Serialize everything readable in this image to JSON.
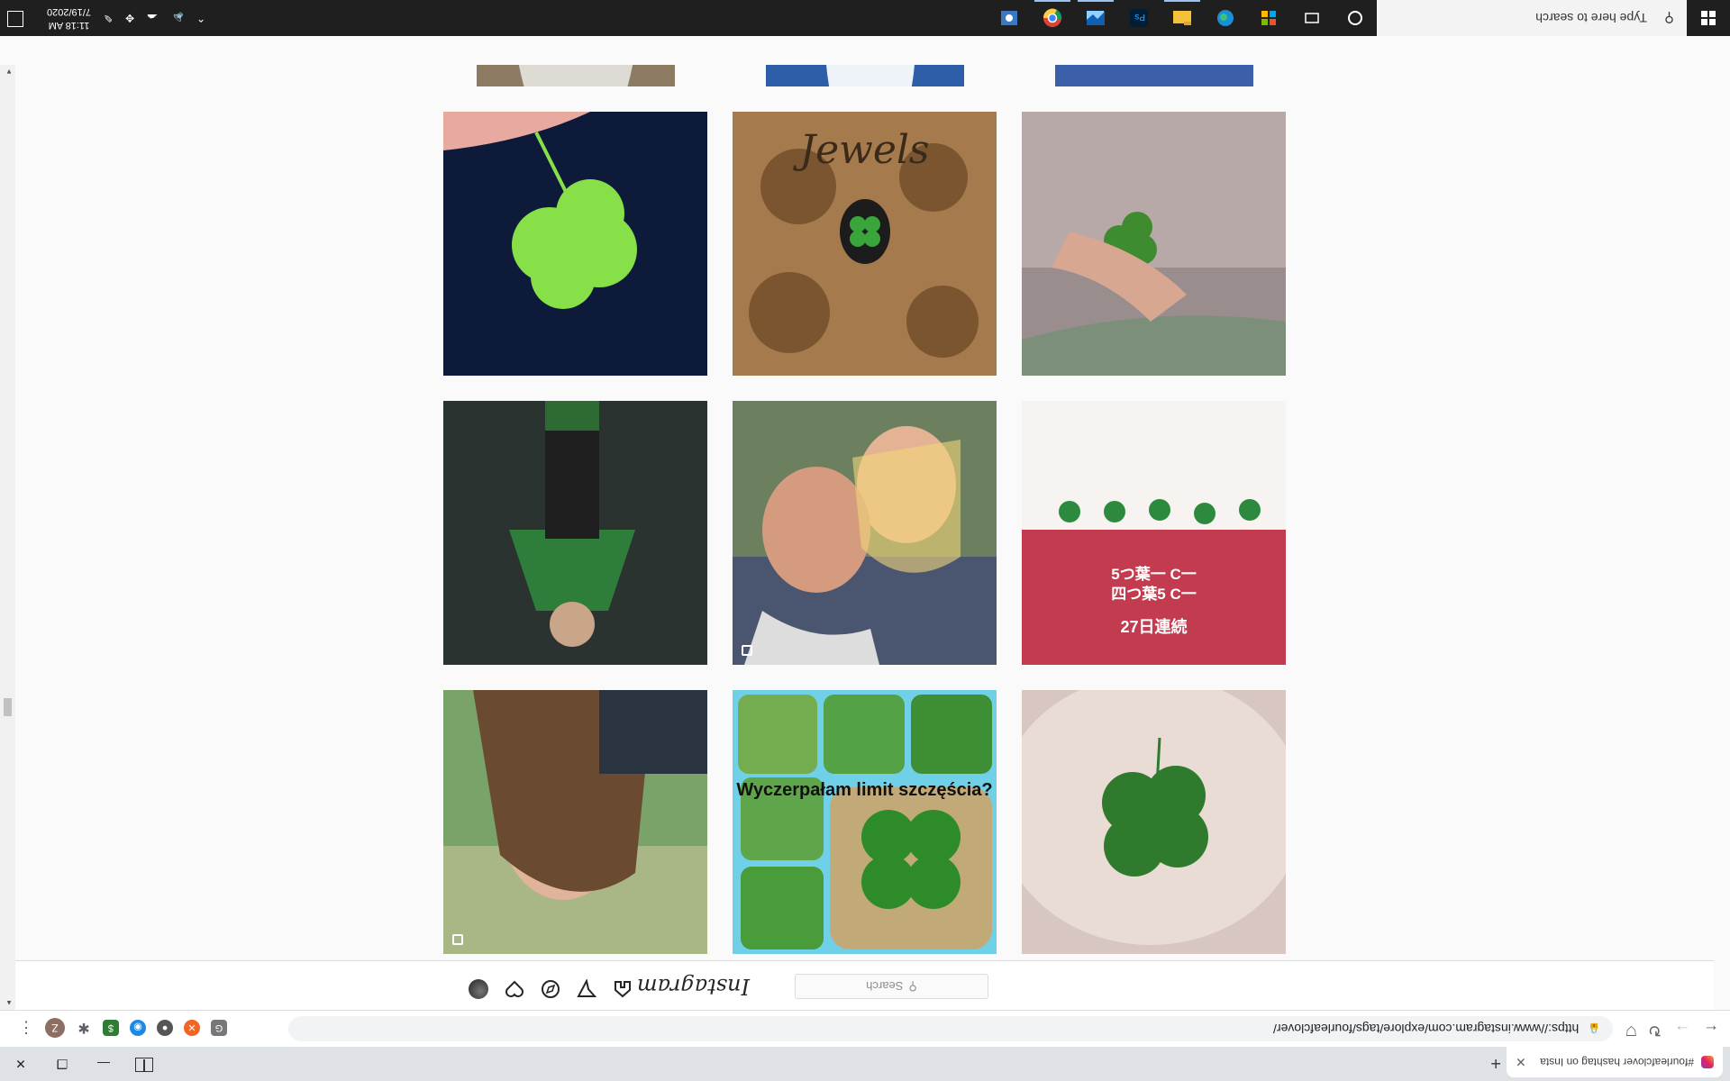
{
  "browser": {
    "tab_title": "#fourleafclover hashtag on Insta",
    "new_tab": "+",
    "url": "https://www.instagram.com/explore/tags/fourleafclover/",
    "profile_initial": "Z"
  },
  "instagram": {
    "logo": "Instagram",
    "search_placeholder": "Search",
    "grid_texts": {
      "jewels": "Jewels",
      "wyczerpalam": "Wyczerpałam limit szczęścia?",
      "jp_top": "27日連続",
      "jp_mid": "四つ葉5 C一",
      "jp_low": "5つ葉一 C一"
    }
  },
  "taskbar": {
    "search_placeholder": "Type here to search",
    "time": "11:18 AM",
    "date": "7/19/2020"
  },
  "colors": {
    "instagram_gradient_start": "#f9a03c",
    "taskbar_bg": "#1f1f1f",
    "chrome_frame": "#dee1e6"
  }
}
